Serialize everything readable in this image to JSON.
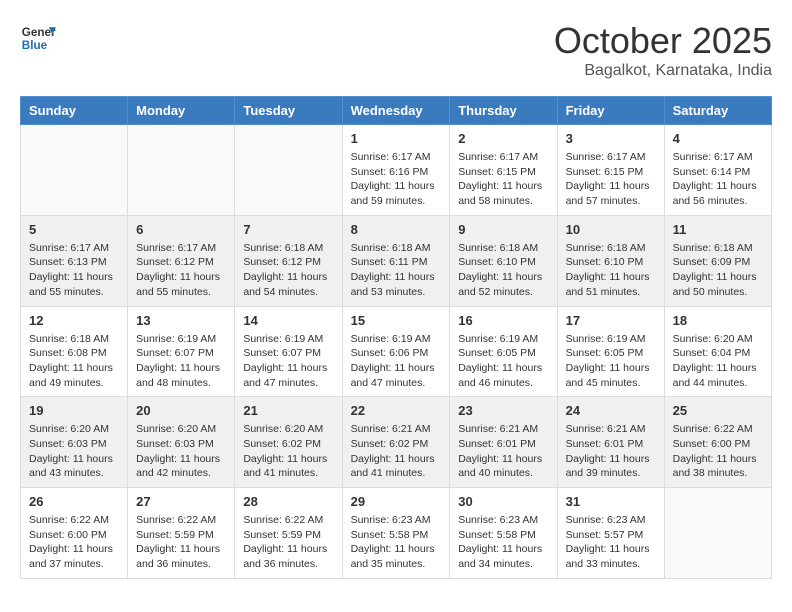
{
  "header": {
    "logo_line1": "General",
    "logo_line2": "Blue",
    "month": "October 2025",
    "location": "Bagalkot, Karnataka, India"
  },
  "weekdays": [
    "Sunday",
    "Monday",
    "Tuesday",
    "Wednesday",
    "Thursday",
    "Friday",
    "Saturday"
  ],
  "rows": [
    [
      {
        "day": "",
        "info": ""
      },
      {
        "day": "",
        "info": ""
      },
      {
        "day": "",
        "info": ""
      },
      {
        "day": "1",
        "info": "Sunrise: 6:17 AM\nSunset: 6:16 PM\nDaylight: 11 hours\nand 59 minutes."
      },
      {
        "day": "2",
        "info": "Sunrise: 6:17 AM\nSunset: 6:15 PM\nDaylight: 11 hours\nand 58 minutes."
      },
      {
        "day": "3",
        "info": "Sunrise: 6:17 AM\nSunset: 6:15 PM\nDaylight: 11 hours\nand 57 minutes."
      },
      {
        "day": "4",
        "info": "Sunrise: 6:17 AM\nSunset: 6:14 PM\nDaylight: 11 hours\nand 56 minutes."
      }
    ],
    [
      {
        "day": "5",
        "info": "Sunrise: 6:17 AM\nSunset: 6:13 PM\nDaylight: 11 hours\nand 55 minutes."
      },
      {
        "day": "6",
        "info": "Sunrise: 6:17 AM\nSunset: 6:12 PM\nDaylight: 11 hours\nand 55 minutes."
      },
      {
        "day": "7",
        "info": "Sunrise: 6:18 AM\nSunset: 6:12 PM\nDaylight: 11 hours\nand 54 minutes."
      },
      {
        "day": "8",
        "info": "Sunrise: 6:18 AM\nSunset: 6:11 PM\nDaylight: 11 hours\nand 53 minutes."
      },
      {
        "day": "9",
        "info": "Sunrise: 6:18 AM\nSunset: 6:10 PM\nDaylight: 11 hours\nand 52 minutes."
      },
      {
        "day": "10",
        "info": "Sunrise: 6:18 AM\nSunset: 6:10 PM\nDaylight: 11 hours\nand 51 minutes."
      },
      {
        "day": "11",
        "info": "Sunrise: 6:18 AM\nSunset: 6:09 PM\nDaylight: 11 hours\nand 50 minutes."
      }
    ],
    [
      {
        "day": "12",
        "info": "Sunrise: 6:18 AM\nSunset: 6:08 PM\nDaylight: 11 hours\nand 49 minutes."
      },
      {
        "day": "13",
        "info": "Sunrise: 6:19 AM\nSunset: 6:07 PM\nDaylight: 11 hours\nand 48 minutes."
      },
      {
        "day": "14",
        "info": "Sunrise: 6:19 AM\nSunset: 6:07 PM\nDaylight: 11 hours\nand 47 minutes."
      },
      {
        "day": "15",
        "info": "Sunrise: 6:19 AM\nSunset: 6:06 PM\nDaylight: 11 hours\nand 47 minutes."
      },
      {
        "day": "16",
        "info": "Sunrise: 6:19 AM\nSunset: 6:05 PM\nDaylight: 11 hours\nand 46 minutes."
      },
      {
        "day": "17",
        "info": "Sunrise: 6:19 AM\nSunset: 6:05 PM\nDaylight: 11 hours\nand 45 minutes."
      },
      {
        "day": "18",
        "info": "Sunrise: 6:20 AM\nSunset: 6:04 PM\nDaylight: 11 hours\nand 44 minutes."
      }
    ],
    [
      {
        "day": "19",
        "info": "Sunrise: 6:20 AM\nSunset: 6:03 PM\nDaylight: 11 hours\nand 43 minutes."
      },
      {
        "day": "20",
        "info": "Sunrise: 6:20 AM\nSunset: 6:03 PM\nDaylight: 11 hours\nand 42 minutes."
      },
      {
        "day": "21",
        "info": "Sunrise: 6:20 AM\nSunset: 6:02 PM\nDaylight: 11 hours\nand 41 minutes."
      },
      {
        "day": "22",
        "info": "Sunrise: 6:21 AM\nSunset: 6:02 PM\nDaylight: 11 hours\nand 41 minutes."
      },
      {
        "day": "23",
        "info": "Sunrise: 6:21 AM\nSunset: 6:01 PM\nDaylight: 11 hours\nand 40 minutes."
      },
      {
        "day": "24",
        "info": "Sunrise: 6:21 AM\nSunset: 6:01 PM\nDaylight: 11 hours\nand 39 minutes."
      },
      {
        "day": "25",
        "info": "Sunrise: 6:22 AM\nSunset: 6:00 PM\nDaylight: 11 hours\nand 38 minutes."
      }
    ],
    [
      {
        "day": "26",
        "info": "Sunrise: 6:22 AM\nSunset: 6:00 PM\nDaylight: 11 hours\nand 37 minutes."
      },
      {
        "day": "27",
        "info": "Sunrise: 6:22 AM\nSunset: 5:59 PM\nDaylight: 11 hours\nand 36 minutes."
      },
      {
        "day": "28",
        "info": "Sunrise: 6:22 AM\nSunset: 5:59 PM\nDaylight: 11 hours\nand 36 minutes."
      },
      {
        "day": "29",
        "info": "Sunrise: 6:23 AM\nSunset: 5:58 PM\nDaylight: 11 hours\nand 35 minutes."
      },
      {
        "day": "30",
        "info": "Sunrise: 6:23 AM\nSunset: 5:58 PM\nDaylight: 11 hours\nand 34 minutes."
      },
      {
        "day": "31",
        "info": "Sunrise: 6:23 AM\nSunset: 5:57 PM\nDaylight: 11 hours\nand 33 minutes."
      },
      {
        "day": "",
        "info": ""
      }
    ]
  ]
}
